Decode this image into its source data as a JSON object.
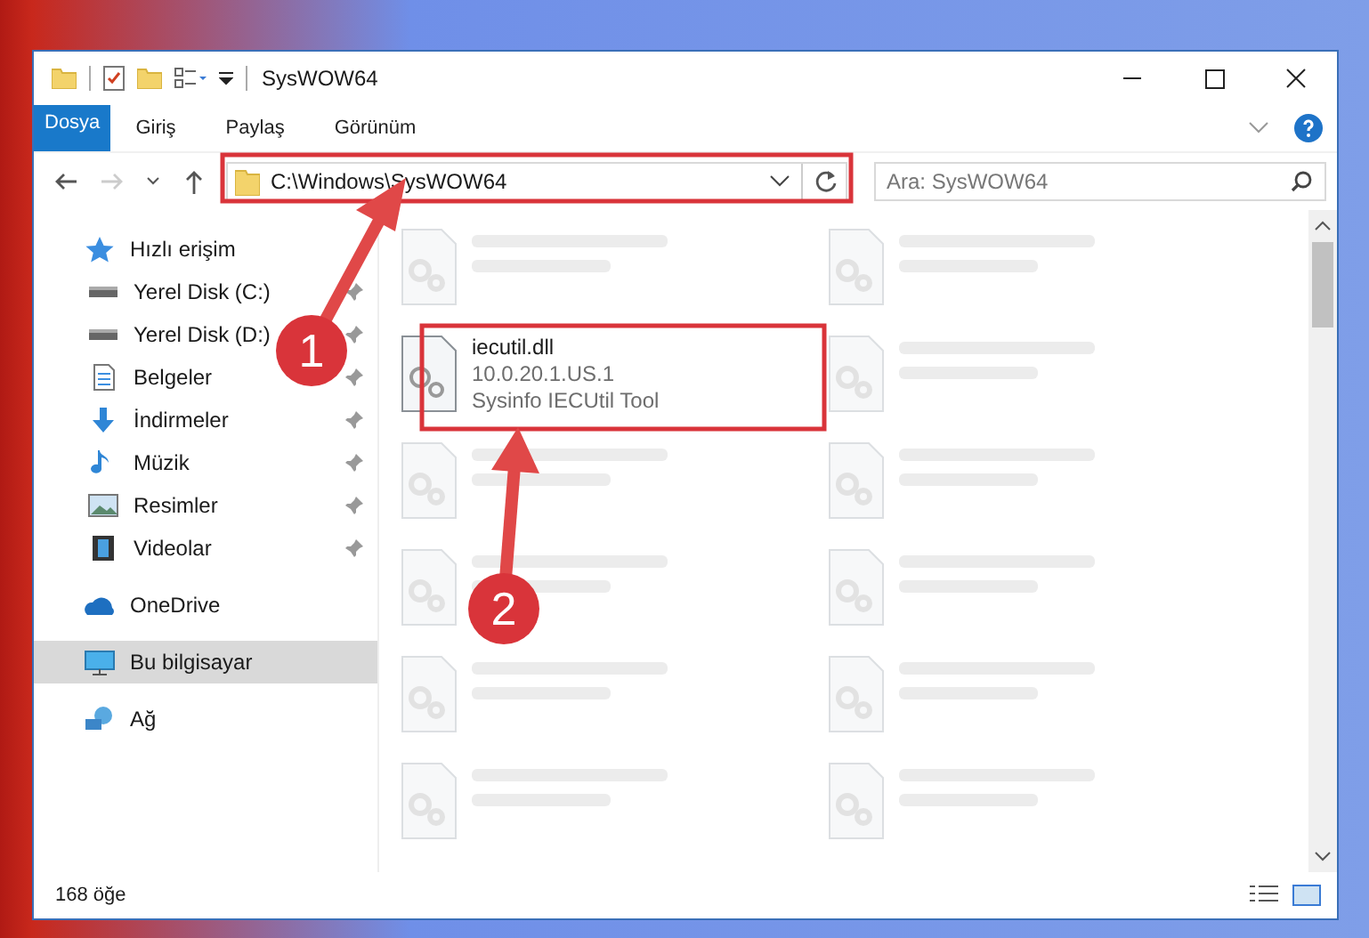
{
  "window": {
    "title": "SysWOW64"
  },
  "ribbon_tabs": [
    {
      "label": "Dosya",
      "kind": "file"
    },
    {
      "label": "Giriş",
      "kind": "tab"
    },
    {
      "label": "Paylaş",
      "kind": "tab"
    },
    {
      "label": "Görünüm",
      "kind": "tab"
    }
  ],
  "address": {
    "value": "C:\\Windows\\SysWOW64"
  },
  "search": {
    "placeholder": "Ara: SysWOW64"
  },
  "sidebar": {
    "items": [
      {
        "label": "Hızlı erişim",
        "selected": false,
        "children": [
          {
            "label": "Yerel Disk (C:)",
            "pinned": true
          },
          {
            "label": "Yerel Disk (D:)",
            "pinned": true
          },
          {
            "label": "Belgeler",
            "pinned": true
          },
          {
            "label": "İndirmeler",
            "pinned": true
          },
          {
            "label": "Müzik",
            "pinned": true
          },
          {
            "label": "Resimler",
            "pinned": true
          },
          {
            "label": "Videolar",
            "pinned": true
          }
        ]
      },
      {
        "label": "OneDrive",
        "selected": false
      },
      {
        "label": "Bu bilgisayar",
        "selected": true
      },
      {
        "label": "Ağ",
        "selected": false
      }
    ]
  },
  "files": [
    {
      "kind": "blurred"
    },
    {
      "kind": "blurred"
    },
    {
      "name": "iecutil.dll",
      "lines": [
        "10.0.20.1.US.1",
        "Sysinfo IECUtil Tool"
      ],
      "kind": "highlighted"
    },
    {
      "kind": "blurred"
    },
    {
      "kind": "blurred"
    },
    {
      "kind": "blurred"
    },
    {
      "kind": "blurred"
    },
    {
      "kind": "blurred"
    },
    {
      "kind": "blurred"
    },
    {
      "kind": "blurred"
    },
    {
      "kind": "blurred"
    },
    {
      "kind": "blurred"
    }
  ],
  "status_bar": {
    "count": "168 öğe"
  },
  "annotations": [
    {
      "number": "1"
    },
    {
      "number": "2"
    }
  ]
}
